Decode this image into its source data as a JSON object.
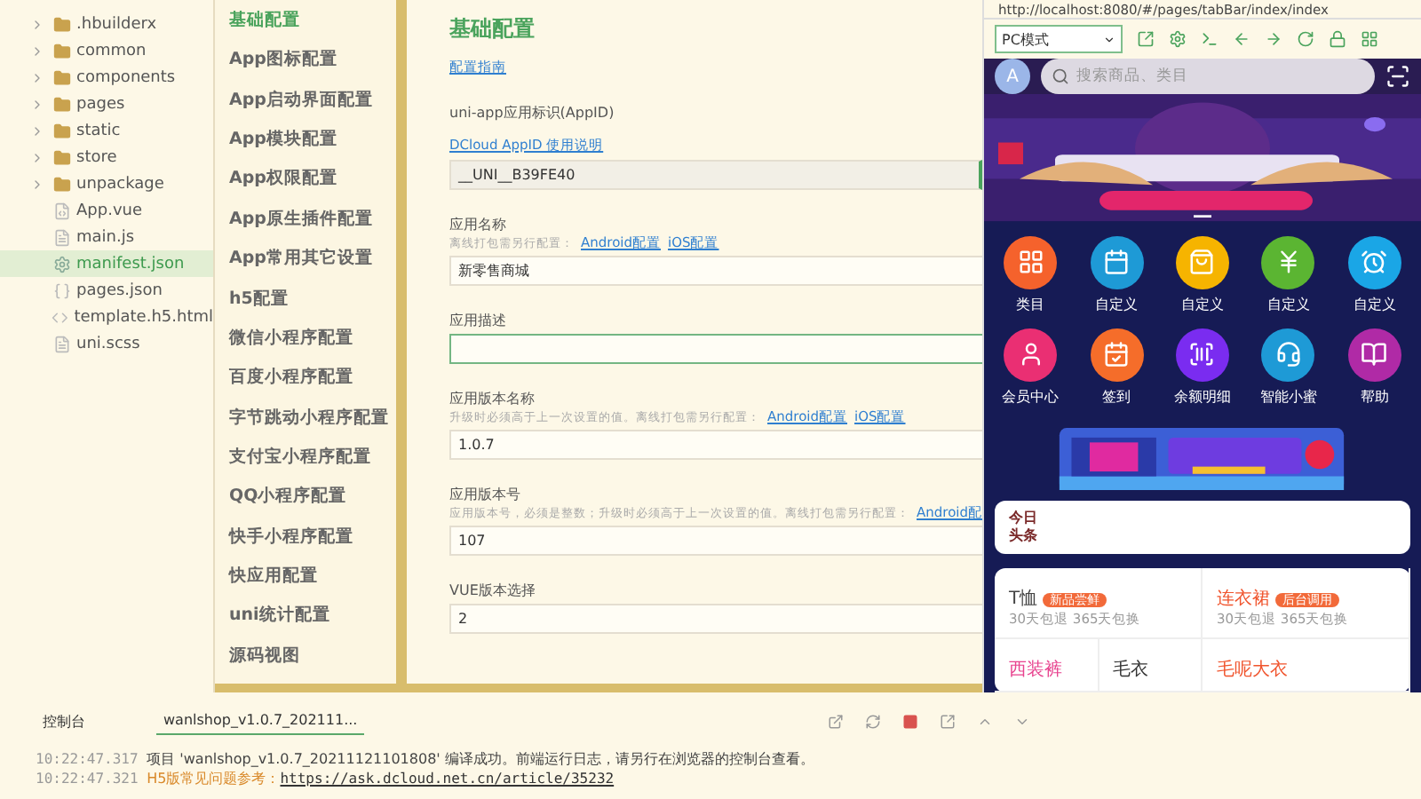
{
  "file_tree": [
    {
      "name": ".hbuilderx",
      "kind": "folder",
      "selected": false
    },
    {
      "name": "common",
      "kind": "folder",
      "selected": false
    },
    {
      "name": "components",
      "kind": "folder",
      "selected": false
    },
    {
      "name": "pages",
      "kind": "folder",
      "selected": false
    },
    {
      "name": "static",
      "kind": "folder",
      "selected": false
    },
    {
      "name": "store",
      "kind": "folder",
      "selected": false
    },
    {
      "name": "unpackage",
      "kind": "folder",
      "selected": false
    },
    {
      "name": "App.vue",
      "kind": "vue",
      "selected": false
    },
    {
      "name": "main.js",
      "kind": "js",
      "selected": false
    },
    {
      "name": "manifest.json",
      "kind": "manifest",
      "selected": true
    },
    {
      "name": "pages.json",
      "kind": "json",
      "selected": false
    },
    {
      "name": "template.h5.html",
      "kind": "html",
      "selected": false
    },
    {
      "name": "uni.scss",
      "kind": "scss",
      "selected": false
    }
  ],
  "config_nav": [
    {
      "label": "基础配置",
      "selected": true
    },
    {
      "label": "App图标配置",
      "selected": false
    },
    {
      "label": "App启动界面配置",
      "selected": false
    },
    {
      "label": "App模块配置",
      "selected": false
    },
    {
      "label": "App权限配置",
      "selected": false
    },
    {
      "label": "App原生插件配置",
      "selected": false
    },
    {
      "label": "App常用其它设置",
      "selected": false
    },
    {
      "label": "h5配置",
      "selected": false
    },
    {
      "label": "微信小程序配置",
      "selected": false
    },
    {
      "label": "百度小程序配置",
      "selected": false
    },
    {
      "label": "字节跳动小程序配置",
      "selected": false
    },
    {
      "label": "支付宝小程序配置",
      "selected": false
    },
    {
      "label": "QQ小程序配置",
      "selected": false
    },
    {
      "label": "快手小程序配置",
      "selected": false
    },
    {
      "label": "快应用配置",
      "selected": false
    },
    {
      "label": "uni统计配置",
      "selected": false
    },
    {
      "label": "源码视图",
      "selected": false
    }
  ],
  "form": {
    "title": "基础配置",
    "guide_link": "配置指南",
    "fields": [
      {
        "label": "uni-app应用标识(AppID)",
        "link": "DCloud AppID 使用说明",
        "value": "__UNI__B39FE40",
        "disabled": true
      },
      {
        "label": "应用名称",
        "hint": "离线打包需另行配置：",
        "hint_links": [
          "Android配置",
          "iOS配置"
        ],
        "value": "新零售商城",
        "disabled": false
      },
      {
        "label": "应用描述",
        "focused": true,
        "disabled": false
      },
      {
        "label": "应用版本名称",
        "hint": "升级时必须高于上一次设置的值。离线打包需另行配置：",
        "hint_links": [
          "Android配置",
          "iOS配置"
        ],
        "value": "1.0.7",
        "disabled": false
      },
      {
        "label": "应用版本号",
        "hint": "应用版本号，必须是整数；升级时必须高于上一次设置的值。离线打包需另行配置：",
        "hint_links": [
          "Android配"
        ],
        "value": "107",
        "disabled": false
      },
      {
        "label": "VUE版本选择",
        "value": "2",
        "disabled": false
      }
    ]
  },
  "preview": {
    "url": "http://localhost:8080/#/pages/tabBar/index/index",
    "mode": "PC模式",
    "avatar": "A",
    "search_placeholder": "搜索商品、类目",
    "shortcuts": [
      {
        "label": "类目",
        "color": "#f5622c"
      },
      {
        "label": "自定义",
        "color": "#1e9ad6"
      },
      {
        "label": "自定义",
        "color": "#f6b400"
      },
      {
        "label": "自定义",
        "color": "#5bb532"
      },
      {
        "label": "自定义",
        "color": "#1aa6e6"
      },
      {
        "label": "会员中心",
        "color": "#ea2f73"
      },
      {
        "label": "签到",
        "color": "#f56d2a"
      },
      {
        "label": "余额明细",
        "color": "#7a2cf0"
      },
      {
        "label": "智能小蜜",
        "color": "#1e9ad6"
      },
      {
        "label": "帮助",
        "color": "#b02aa6"
      }
    ],
    "headline": [
      "今日",
      "头条"
    ],
    "products": [
      {
        "name": "T恤",
        "badge": "新品尝鲜",
        "desc": "30天包退 365天包换",
        "color": "#444444"
      },
      {
        "name": "连衣裙",
        "badge": "后台调用",
        "desc": "30天包退 365天包换",
        "color": "#f0542d"
      },
      {
        "name": "西装裤",
        "color": "#e8438f"
      },
      {
        "name": "毛衣",
        "color": "#333333"
      },
      {
        "name": "毛呢大衣",
        "color": "#f0542d"
      }
    ]
  },
  "console": {
    "tabs": [
      {
        "label": "控制台",
        "selected": false
      },
      {
        "label": "wanlshop_v1.0.7_202111...",
        "selected": true
      }
    ],
    "lines": [
      {
        "time": "10:22:47.317",
        "text": "项目 'wanlshop_v1.0.7_20211121101808' 编译成功。前端运行日志，请另行在浏览器的控制台查看。",
        "kind": "info"
      },
      {
        "time": "10:22:47.321",
        "text": "H5版常见问题参考：",
        "link": "https://ask.dcloud.net.cn/article/35232",
        "kind": "warn"
      }
    ]
  }
}
